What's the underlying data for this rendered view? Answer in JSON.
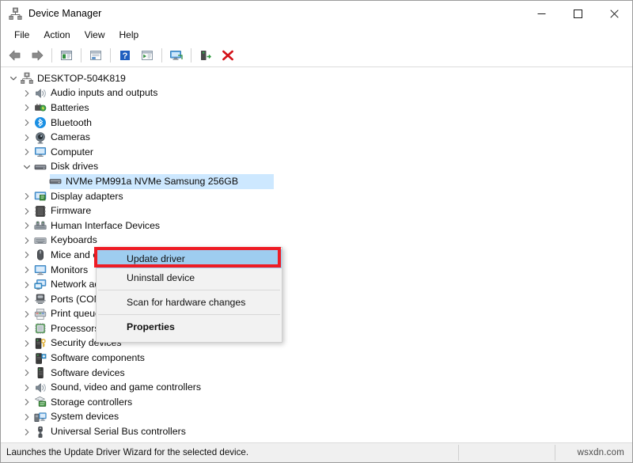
{
  "window": {
    "title": "Device Manager",
    "title_icon": "device-manager-icon",
    "minimize_label": "─",
    "maximize_label": "□",
    "close_label": "✕"
  },
  "menubar": {
    "items": [
      {
        "label": "File",
        "name": "menu-file"
      },
      {
        "label": "Action",
        "name": "menu-action"
      },
      {
        "label": "View",
        "name": "menu-view"
      },
      {
        "label": "Help",
        "name": "menu-help"
      }
    ]
  },
  "toolbar": {
    "buttons": [
      {
        "name": "back-icon",
        "tooltip": "Back"
      },
      {
        "name": "forward-icon",
        "tooltip": "Forward"
      },
      {
        "name": "show-hide-console-tree-icon",
        "tooltip": "Show/Hide Console Tree"
      },
      {
        "name": "properties-icon",
        "tooltip": "Properties"
      },
      {
        "name": "help-icon",
        "tooltip": "Help"
      },
      {
        "name": "update-driver-icon",
        "tooltip": "Update Driver Software"
      },
      {
        "name": "scan-for-hardware-changes-icon",
        "tooltip": "Scan for hardware changes"
      },
      {
        "name": "enable-device-icon",
        "tooltip": "Enable device"
      },
      {
        "name": "uninstall-device-icon",
        "tooltip": "Uninstall device"
      }
    ]
  },
  "tree": {
    "root": {
      "label": "DESKTOP-504K819",
      "icon": "computer-node-icon",
      "expanded": true
    },
    "items": [
      {
        "label": "Audio inputs and outputs",
        "icon": "speaker-icon",
        "level": 1,
        "expanded": false
      },
      {
        "label": "Batteries",
        "icon": "battery-icon",
        "level": 1,
        "expanded": false
      },
      {
        "label": "Bluetooth",
        "icon": "bluetooth-icon",
        "level": 1,
        "expanded": false
      },
      {
        "label": "Cameras",
        "icon": "camera-icon",
        "level": 1,
        "expanded": false
      },
      {
        "label": "Computer",
        "icon": "computer-icon",
        "level": 1,
        "expanded": false
      },
      {
        "label": "Disk drives",
        "icon": "disk-drive-icon",
        "level": 1,
        "expanded": true
      },
      {
        "label": "NVMe PM991a NVMe Samsung 256GB",
        "icon": "disk-drive-icon",
        "level": 2,
        "expanded": null,
        "selected": true
      },
      {
        "label": "Display adapters",
        "icon": "display-adapter-icon",
        "level": 1,
        "expanded": false
      },
      {
        "label": "Firmware",
        "icon": "firmware-icon",
        "level": 1,
        "expanded": false
      },
      {
        "label": "Human Interface Devices",
        "icon": "hid-icon",
        "level": 1,
        "expanded": false
      },
      {
        "label": "Keyboards",
        "icon": "keyboard-icon",
        "level": 1,
        "expanded": false
      },
      {
        "label": "Mice and other pointing devices",
        "icon": "mouse-icon",
        "level": 1,
        "expanded": false
      },
      {
        "label": "Monitors",
        "icon": "monitor-icon",
        "level": 1,
        "expanded": false
      },
      {
        "label": "Network adapters",
        "icon": "network-adapter-icon",
        "level": 1,
        "expanded": false
      },
      {
        "label": "Ports (COM & LPT)",
        "icon": "port-icon",
        "level": 1,
        "expanded": false
      },
      {
        "label": "Print queues",
        "icon": "printer-icon",
        "level": 1,
        "expanded": false
      },
      {
        "label": "Processors",
        "icon": "processor-icon",
        "level": 1,
        "expanded": false
      },
      {
        "label": "Security devices",
        "icon": "security-device-icon",
        "level": 1,
        "expanded": false
      },
      {
        "label": "Software components",
        "icon": "software-component-icon",
        "level": 1,
        "expanded": false
      },
      {
        "label": "Software devices",
        "icon": "software-device-icon",
        "level": 1,
        "expanded": false
      },
      {
        "label": "Sound, video and game controllers",
        "icon": "speaker-icon",
        "level": 1,
        "expanded": false
      },
      {
        "label": "Storage controllers",
        "icon": "storage-controller-icon",
        "level": 1,
        "expanded": false
      },
      {
        "label": "System devices",
        "icon": "system-device-icon",
        "level": 1,
        "expanded": false
      },
      {
        "label": "Universal Serial Bus controllers",
        "icon": "usb-icon",
        "level": 1,
        "expanded": false
      }
    ]
  },
  "context_menu": {
    "items": [
      {
        "label": "Update driver",
        "name": "context-menu-update-driver",
        "highlighted": true,
        "bold": false
      },
      {
        "label": "Uninstall device",
        "name": "context-menu-uninstall-device",
        "highlighted": false,
        "bold": false
      },
      {
        "label": "Scan for hardware changes",
        "name": "context-menu-scan-for-hardware-changes",
        "highlighted": false,
        "bold": false
      },
      {
        "label": "Properties",
        "name": "context-menu-properties",
        "highlighted": false,
        "bold": true
      }
    ]
  },
  "statusbar": {
    "text": "Launches the Update Driver Wizard for the selected device.",
    "watermark": "wsxdn.com"
  },
  "colors": {
    "selection_blue": "#cde8ff",
    "menu_highlight_blue": "#9ecdf0",
    "annotation_red": "#ee1c25",
    "status_background": "#f0f0f0",
    "menu_background": "#f2f2f2"
  }
}
